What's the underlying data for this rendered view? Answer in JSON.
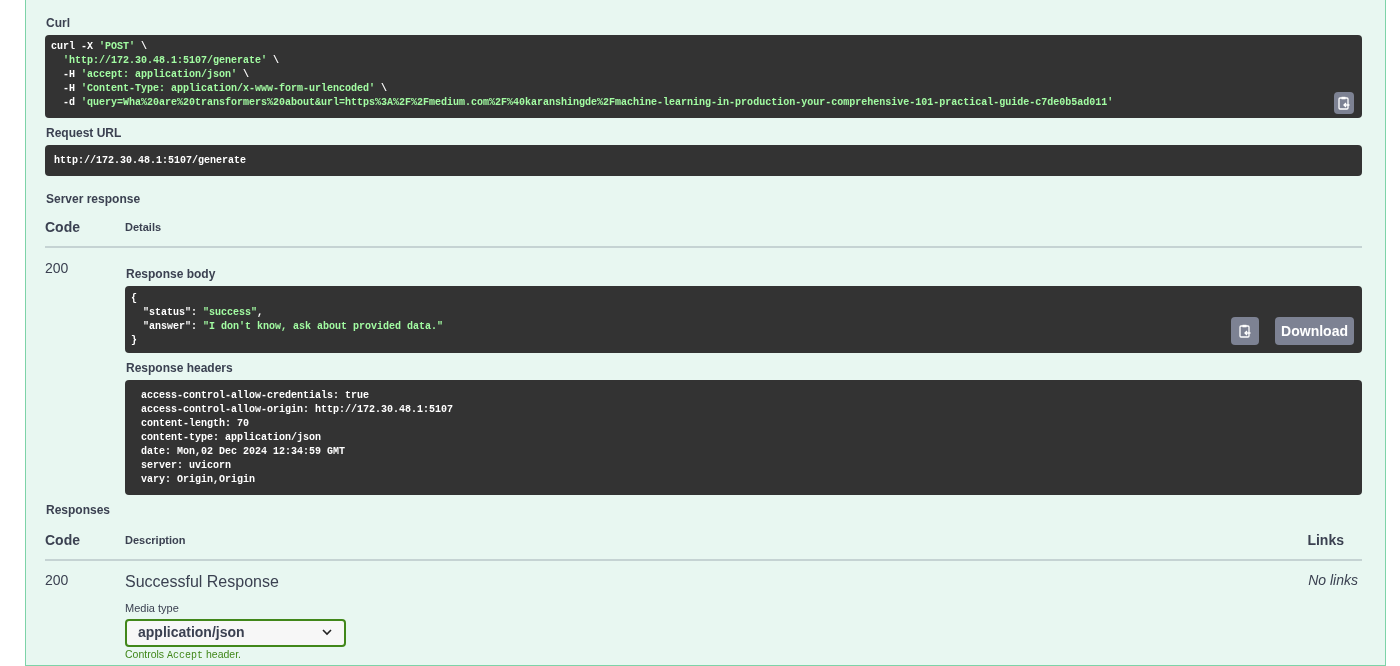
{
  "curl": {
    "label": "Curl",
    "lines": [
      [
        {
          "kind": "plain",
          "text": "curl -X "
        },
        {
          "kind": "string",
          "text": "'POST'"
        },
        {
          "kind": "plain",
          "text": " \\"
        }
      ],
      [
        {
          "kind": "string",
          "text": "  'http://172.30.48.1:5107/generate'"
        },
        {
          "kind": "plain",
          "text": " \\"
        }
      ],
      [
        {
          "kind": "plain",
          "text": "  -H "
        },
        {
          "kind": "string",
          "text": "'accept: application/json'"
        },
        {
          "kind": "plain",
          "text": " \\"
        }
      ],
      [
        {
          "kind": "plain",
          "text": "  -H "
        },
        {
          "kind": "string",
          "text": "'Content-Type: application/x-www-form-urlencoded'"
        },
        {
          "kind": "plain",
          "text": " \\"
        }
      ],
      [
        {
          "kind": "plain",
          "text": "  -d "
        },
        {
          "kind": "string",
          "text": "'query=Wha%20are%20transformers%20about&url=https%3A%2F%2Fmedium.com%2F%40karanshingde%2Fmachine-learning-in-production-your-comprehensive-101-practical-guide-c7de0b5ad011'"
        }
      ]
    ]
  },
  "request_url": {
    "label": "Request URL",
    "value": "http://172.30.48.1:5107/generate"
  },
  "server_response": {
    "label": "Server response",
    "columns": [
      "Code",
      "Details"
    ],
    "code": "200",
    "body_label": "Response body",
    "body_lines": [
      [
        {
          "kind": "plain",
          "text": "{"
        }
      ],
      [
        {
          "kind": "plain",
          "text": "  \"status\": "
        },
        {
          "kind": "string",
          "text": "\"success\""
        },
        {
          "kind": "plain",
          "text": ","
        }
      ],
      [
        {
          "kind": "plain",
          "text": "  \"answer\": "
        },
        {
          "kind": "string",
          "text": "\"I don't know, ask about provided data.\""
        }
      ],
      [
        {
          "kind": "plain",
          "text": "}"
        }
      ]
    ],
    "download": "Download",
    "headers_label": "Response headers",
    "headers": [
      "access-control-allow-credentials: true",
      "access-control-allow-origin: http://172.30.48.1:5107",
      "content-length: 70",
      "content-type: application/json",
      "date: Mon,02 Dec 2024 12:34:59 GMT",
      "server: uvicorn",
      "vary: Origin,Origin"
    ]
  },
  "responses": {
    "label": "Responses",
    "columns": [
      "Code",
      "Description",
      "Links"
    ],
    "rows": [
      {
        "code": "200",
        "description": "Successful Response",
        "media_type_label": "Media type",
        "media_type": "application/json",
        "hint_before": "Controls ",
        "hint_code": "Accept",
        "hint_after": " header.",
        "links": "No links"
      }
    ]
  }
}
